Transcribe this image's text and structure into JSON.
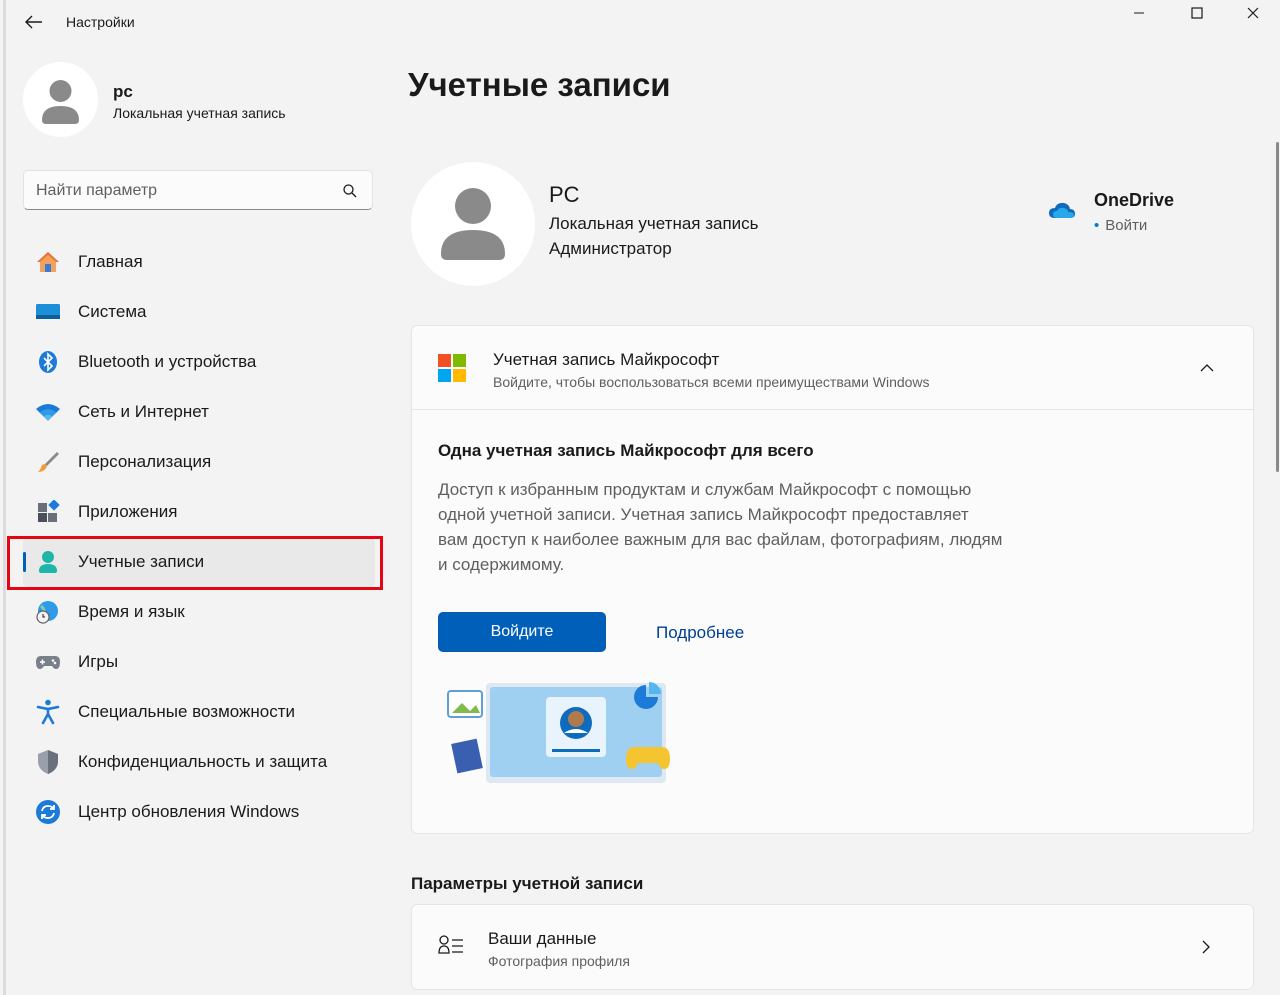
{
  "titlebar": {
    "app_title": "Настройки"
  },
  "profile": {
    "name": "pc",
    "subtitle": "Локальная учетная запись"
  },
  "search": {
    "placeholder": "Найти параметр"
  },
  "nav": {
    "items": [
      {
        "label": "Главная",
        "icon": "home-icon"
      },
      {
        "label": "Система",
        "icon": "system-icon"
      },
      {
        "label": "Bluetooth и устройства",
        "icon": "bluetooth-icon"
      },
      {
        "label": "Сеть и Интернет",
        "icon": "wifi-icon"
      },
      {
        "label": "Персонализация",
        "icon": "brush-icon"
      },
      {
        "label": "Приложения",
        "icon": "apps-icon"
      },
      {
        "label": "Учетные записи",
        "icon": "accounts-icon",
        "active": true
      },
      {
        "label": "Время и язык",
        "icon": "time-language-icon"
      },
      {
        "label": "Игры",
        "icon": "gamepad-icon"
      },
      {
        "label": "Специальные возможности",
        "icon": "accessibility-icon"
      },
      {
        "label": "Конфиденциальность и защита",
        "icon": "shield-icon"
      },
      {
        "label": "Центр обновления Windows",
        "icon": "update-icon"
      }
    ]
  },
  "main": {
    "page_title": "Учетные записи",
    "user": {
      "name": "PC",
      "type": "Локальная учетная запись",
      "role": "Администратор"
    },
    "onedrive": {
      "title": "OneDrive",
      "status_dot": "•",
      "action": "Войти"
    },
    "ms_account": {
      "title": "Учетная запись Майкрософт",
      "subtitle": "Войдите, чтобы воспользоваться всеми преимуществами Windows",
      "heading": "Одна учетная запись Майкрософт для всего",
      "description": "Доступ к избранным продуктам и службам Майкрософт с помощью одной учетной записи. Учетная запись Майкрософт предоставляет вам доступ к наиболее важным для вас файлам, фотографиям, людям и содержимому.",
      "signin_button": "Войдите",
      "more_link": "Подробнее"
    },
    "account_settings": {
      "section_title": "Параметры учетной записи",
      "row_title": "Ваши данные",
      "row_subtitle": "Фотография профиля"
    }
  },
  "colors": {
    "accent": "#005fb8",
    "highlight_frame": "#e30613",
    "background": "#f3f3f3",
    "card": "#fbfbfb"
  }
}
